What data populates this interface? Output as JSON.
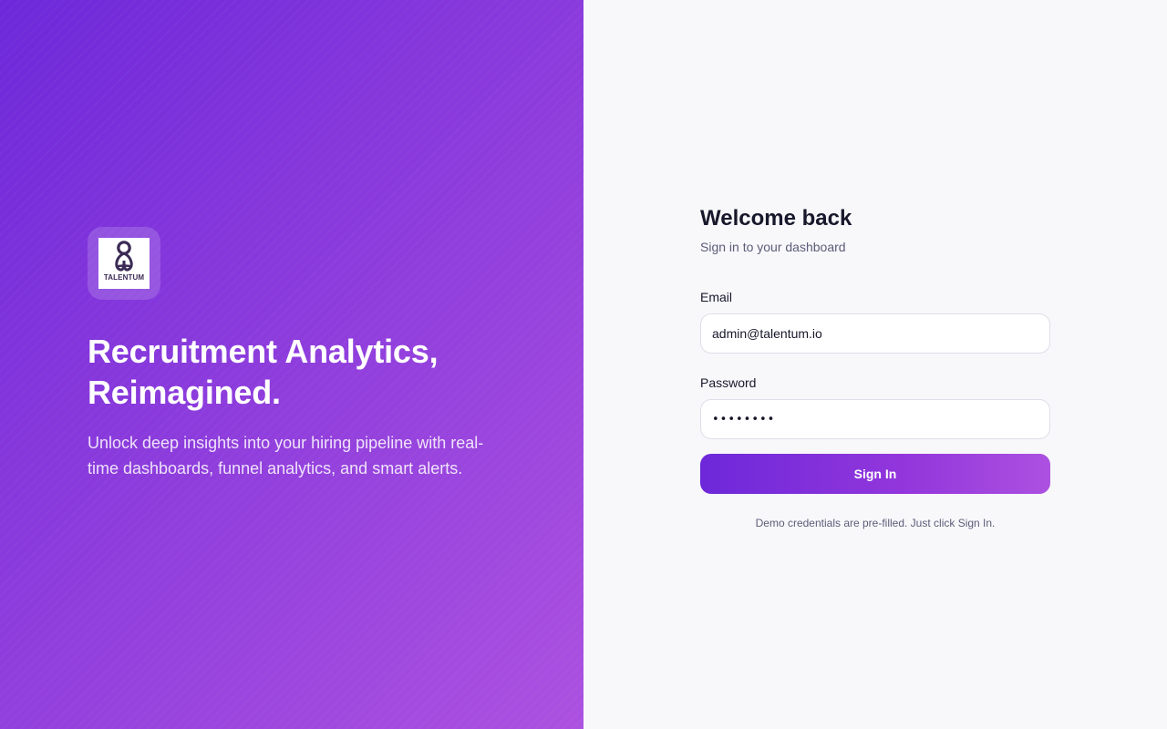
{
  "brand": {
    "logo_text": "TALENTUM",
    "primary_color": "#6d28d9",
    "accent_color": "#ac51e0",
    "logo_icon": "talentum-logo-icon"
  },
  "hero": {
    "title": "Recruitment Analytics, Reimagined.",
    "subtitle": "Unlock deep insights into your hiring pipeline with real-time dashboards, funnel analytics, and smart alerts."
  },
  "login": {
    "title": "Welcome back",
    "subtitle": "Sign in to your dashboard",
    "email_label": "Email",
    "email_value": "admin@talentum.io",
    "password_label": "Password",
    "password_value": "••••••••",
    "submit_label": "Sign In",
    "demo_note": "Demo credentials are pre-filled. Just click Sign In."
  }
}
